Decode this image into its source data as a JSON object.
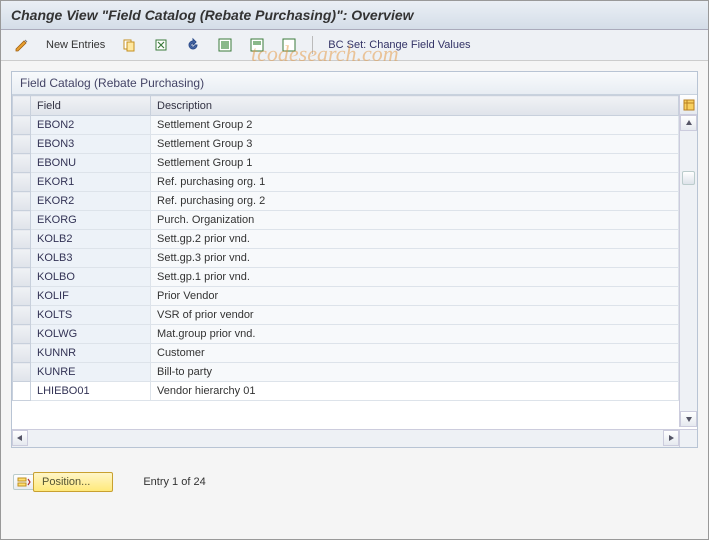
{
  "title": "Change View \"Field Catalog (Rebate Purchasing)\": Overview",
  "toolbar": {
    "new_entries": "New Entries",
    "bc_set_label": "BC Set: Change Field Values"
  },
  "panel": {
    "header": "Field Catalog (Rebate Purchasing)",
    "columns": {
      "field": "Field",
      "description": "Description"
    },
    "rows": [
      {
        "field": "EBON2",
        "desc": "Settlement Group 2"
      },
      {
        "field": "EBON3",
        "desc": "Settlement Group 3"
      },
      {
        "field": "EBONU",
        "desc": "Settlement Group 1"
      },
      {
        "field": "EKOR1",
        "desc": "Ref. purchasing org. 1"
      },
      {
        "field": "EKOR2",
        "desc": "Ref. purchasing org. 2"
      },
      {
        "field": "EKORG",
        "desc": "Purch. Organization"
      },
      {
        "field": "KOLB2",
        "desc": "Sett.gp.2 prior vnd."
      },
      {
        "field": "KOLB3",
        "desc": "Sett.gp.3 prior vnd."
      },
      {
        "field": "KOLBO",
        "desc": "Sett.gp.1 prior vnd."
      },
      {
        "field": "KOLIF",
        "desc": "Prior Vendor"
      },
      {
        "field": "KOLTS",
        "desc": "VSR of prior vendor"
      },
      {
        "field": "KOLWG",
        "desc": "Mat.group prior vnd."
      },
      {
        "field": "KUNNR",
        "desc": "Customer"
      },
      {
        "field": "KUNRE",
        "desc": "Bill-to party"
      },
      {
        "field": "LHIEBO01",
        "desc": "Vendor hierarchy 01"
      }
    ]
  },
  "footer": {
    "position": "Position...",
    "entry": "Entry 1 of 24"
  },
  "watermark": "tcodesearch.com"
}
